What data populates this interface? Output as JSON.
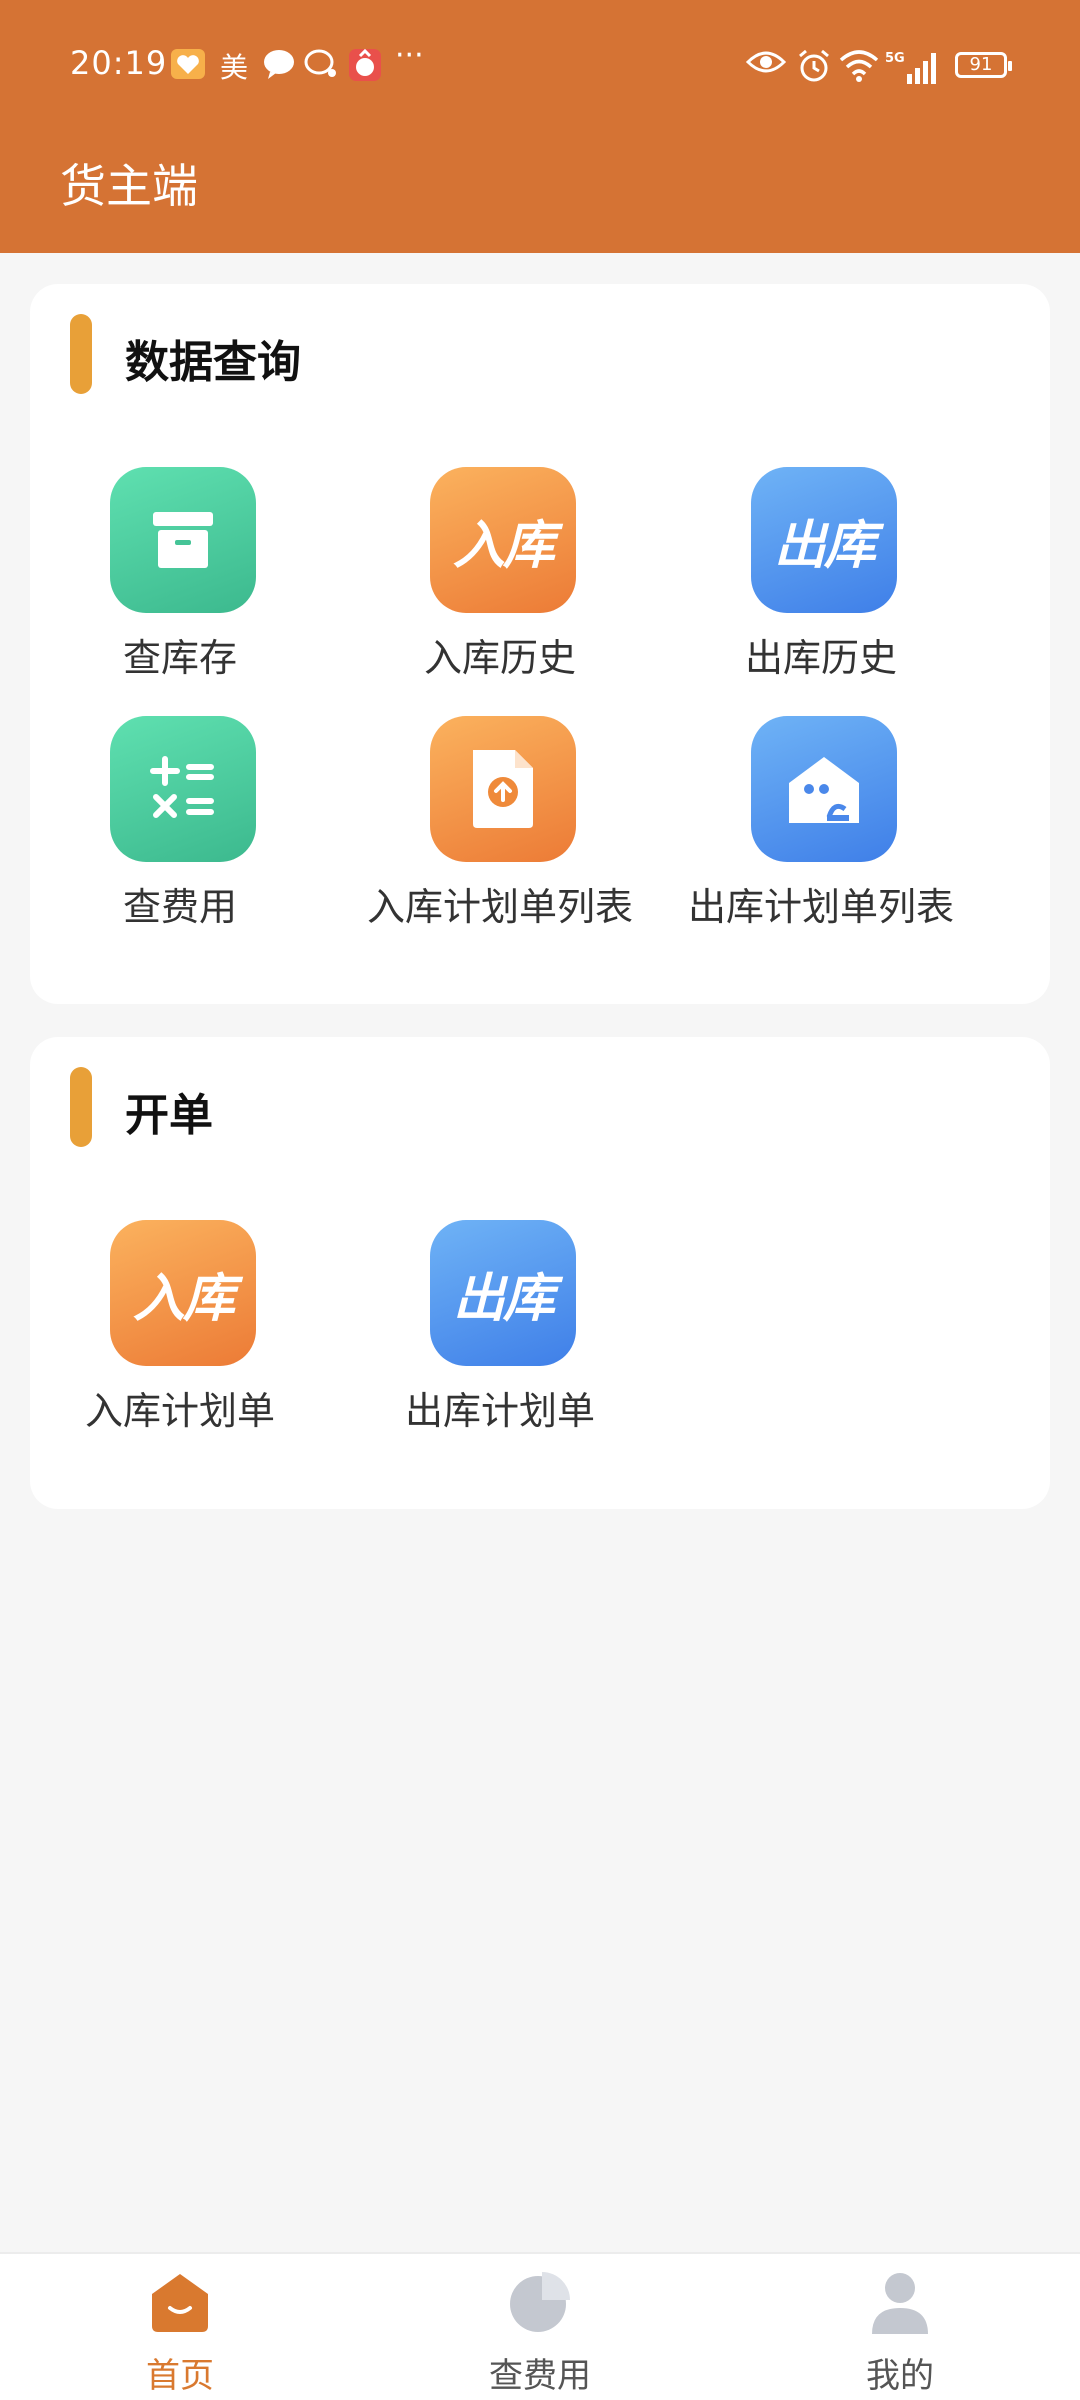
{
  "status_bar": {
    "time": "20:19",
    "carrier_label": "美",
    "more": "···",
    "battery": "91",
    "network": "5G"
  },
  "header": {
    "title": "货主端"
  },
  "sections": [
    {
      "title": "数据查询",
      "items": [
        {
          "label": "查库存",
          "icon": "archive-box-icon",
          "color": "green"
        },
        {
          "label": "入库历史",
          "icon": "inbound-text-icon",
          "icon_text": "入库",
          "color": "orange"
        },
        {
          "label": "出库历史",
          "icon": "outbound-text-icon",
          "icon_text": "出库",
          "color": "blue"
        },
        {
          "label": "查费用",
          "icon": "calculator-icon",
          "color": "green"
        },
        {
          "label": "入库计划单列表",
          "icon": "upload-file-icon",
          "color": "orange"
        },
        {
          "label": "出库计划单列表",
          "icon": "warehouse-icon",
          "color": "blue"
        }
      ]
    },
    {
      "title": "开单",
      "items": [
        {
          "label": "入库计划单",
          "icon": "inbound-text-icon",
          "icon_text": "入库",
          "color": "orange"
        },
        {
          "label": "出库计划单",
          "icon": "outbound-text-icon",
          "icon_text": "出库",
          "color": "blue"
        }
      ]
    }
  ],
  "tabs": [
    {
      "label": "首页",
      "icon": "home-icon",
      "active": true
    },
    {
      "label": "查费用",
      "icon": "pie-chart-icon",
      "active": false
    },
    {
      "label": "我的",
      "icon": "user-icon",
      "active": false
    }
  ],
  "colors": {
    "primary": "#d57334",
    "accent_bar": "#e8a038",
    "active_tab": "#d9792f",
    "inactive_tab": "#555555",
    "background": "#f6f6f6"
  }
}
